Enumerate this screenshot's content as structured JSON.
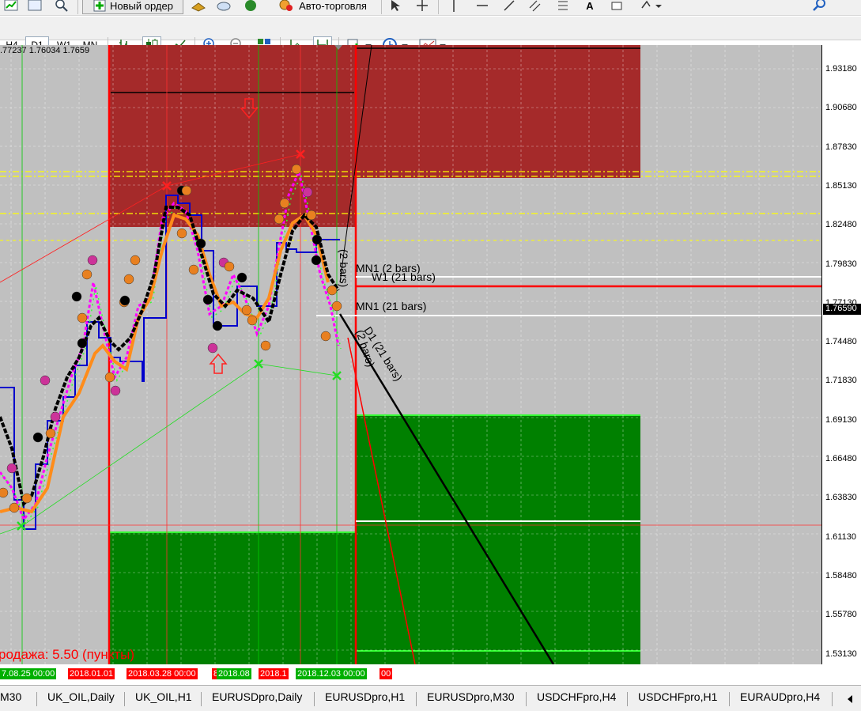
{
  "toolbar": {
    "new_order_label": "Новый ордер",
    "auto_trading_label": "Авто-торговля",
    "text_tool_label": "A"
  },
  "timeframes": [
    {
      "label": "H4",
      "active": false
    },
    {
      "label": "D1",
      "active": true
    },
    {
      "label": "W1",
      "active": false
    },
    {
      "label": "MN",
      "active": false
    }
  ],
  "chart": {
    "ohlc_text": ".77237 1.76034 1.7659",
    "sell_text": "родажа: 5.50 (пункты)",
    "current_price": "1.76590",
    "colors": {
      "background": "#c0c0c0",
      "resistance_zone": "#a52a2a",
      "support_zone": "#008000",
      "price_line": "#0000cc",
      "ma_fast": "#ff8c1a",
      "ma_slow": "#000000",
      "signal": "#ff00ff"
    },
    "line_labels": {
      "mn1_2": "MN1 (2 bars)",
      "w1_21": "W1 (21 bars)",
      "mn1_21": "MN1 (21 bars)",
      "d1_21": "D1 (21 bars)",
      "d1_2": "(2 bars)",
      "w1_2": "(2 bars)"
    }
  },
  "price_axis": {
    "labels": [
      "1.93180",
      "1.90680",
      "1.87830",
      "1.85130",
      "1.82480",
      "1.79830",
      "1.77130",
      "1.74480",
      "1.71830",
      "1.69130",
      "1.66480",
      "1.63830",
      "1.61130",
      "1.58480",
      "1.55780",
      "1.53130"
    ]
  },
  "time_axis": {
    "labels": [
      {
        "text": "7.08.25 00:00",
        "color": "#00b000"
      },
      {
        "text": "2018.01.01",
        "color": "#ff0000"
      },
      {
        "text": "2018.03.28 00:00",
        "color": "#ff0000"
      },
      {
        "text": "8",
        "color": "#ff0000"
      },
      {
        "text": "2018.08",
        "color": "#00b000"
      },
      {
        "text": "2018.1",
        "color": "#ff0000"
      },
      {
        "text": "2018.12.03 00:00",
        "color": "#00b000"
      },
      {
        "text": "00",
        "color": "#ff0000"
      }
    ]
  },
  "tabs": [
    {
      "label": "M30"
    },
    {
      "label": "UK_OIL,Daily"
    },
    {
      "label": "UK_OIL,H1"
    },
    {
      "label": "EURUSDpro,Daily"
    },
    {
      "label": "EURUSDpro,H1"
    },
    {
      "label": "EURUSDpro,M30"
    },
    {
      "label": "USDCHFpro,H4"
    },
    {
      "label": "USDCHFpro,H1"
    },
    {
      "label": "EURAUDpro,H4"
    }
  ]
}
